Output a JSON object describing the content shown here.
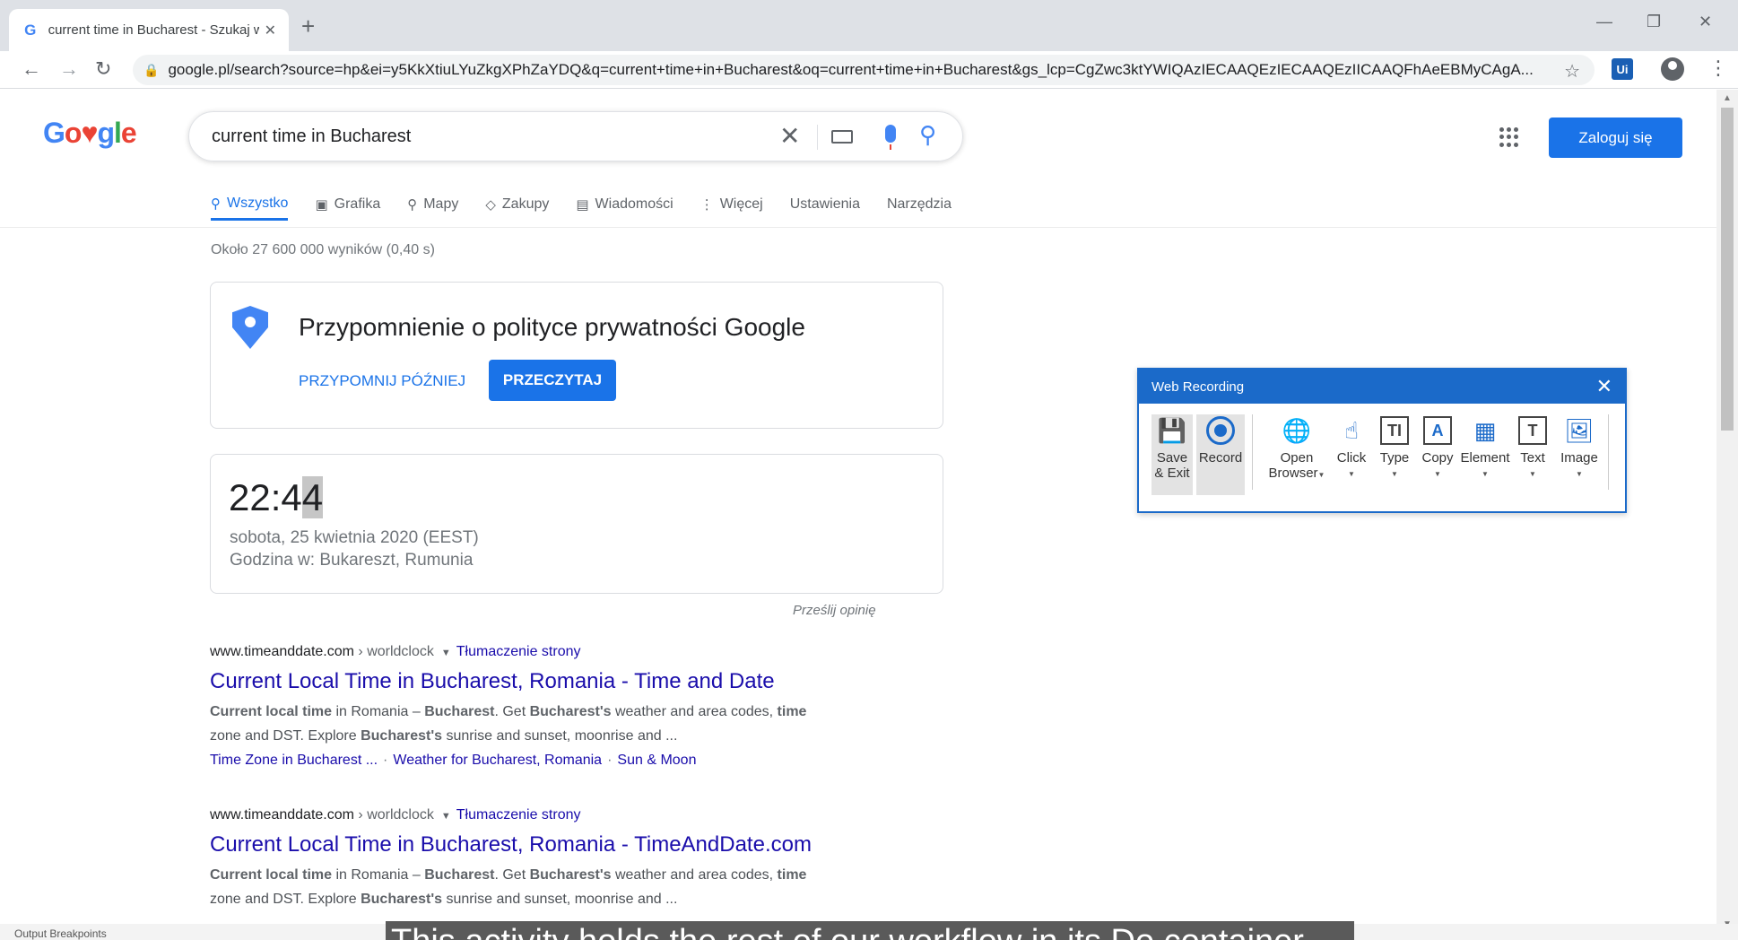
{
  "browser": {
    "tab_title": "current time in Bucharest - Szukaj w Google",
    "url": "google.pl/search?source=hp&ei=y5KkXtiuLYuZkgXPhZaYDQ&q=current+time+in+Bucharest&oq=current+time+in+Bucharest&gs_lcp=CgZwc3ktYWIQAzIECAAQEzIECAAQEzIICAAQFhAeEBMyCAgA...",
    "ext_label": "Ui"
  },
  "google": {
    "query": "current time in Bucharest",
    "signin_label": "Zaloguj się",
    "tabs": [
      {
        "label": "Wszystko",
        "icon": "search-icon"
      },
      {
        "label": "Grafika",
        "icon": "image-icon"
      },
      {
        "label": "Mapy",
        "icon": "map-pin-icon"
      },
      {
        "label": "Zakupy",
        "icon": "tag-icon"
      },
      {
        "label": "Wiadomości",
        "icon": "news-icon"
      },
      {
        "label": "Więcej",
        "icon": "more-vert-icon"
      },
      {
        "label": "Ustawienia"
      },
      {
        "label": "Narzędzia"
      }
    ],
    "stats": "Około 27 600 000 wyników (0,40 s)",
    "privacy": {
      "title": "Przypomnienie o polityce prywatności Google",
      "later": "PRZYPOMNIJ PÓŹNIEJ",
      "read": "PRZECZYTAJ"
    },
    "time_card": {
      "time_main": "22:4",
      "time_highlight": "4",
      "date": "sobota, 25 kwietnia 2020 (EEST)",
      "place": "Godzina w: Bukareszt, Rumunia"
    },
    "feedback": "Prześlij opinię",
    "results": [
      {
        "domain": "www.timeanddate.com",
        "crumb": " › worldclock",
        "translate": "Tłumaczenie strony",
        "title": "Current Local Time in Bucharest, Romania - Time and Date",
        "snippet_line1": [
          "Current local time",
          " in Romania – ",
          "Bucharest",
          ". Get ",
          "Bucharest's",
          " weather and area codes, ",
          "time"
        ],
        "snippet_line2": [
          "zone and DST. Explore ",
          "Bucharest's",
          " sunrise and sunset, moonrise and ..."
        ],
        "links": [
          "Time Zone in Bucharest ...",
          "Weather for Bucharest, Romania",
          "Sun & Moon"
        ]
      },
      {
        "domain": "www.timeanddate.com",
        "crumb": " › worldclock",
        "translate": "Tłumaczenie strony",
        "title": "Current Local Time in Bucharest, Romania - TimeAndDate.com",
        "snippet_line1": [
          "Current local time",
          " in Romania – ",
          "Bucharest",
          ". Get ",
          "Bucharest's",
          " weather and area codes, ",
          "time"
        ],
        "snippet_line2": [
          "zone and DST. Explore ",
          "Bucharest's",
          " sunrise and sunset, moonrise and ..."
        ]
      }
    ]
  },
  "recorder": {
    "title": "Web Recording",
    "tools": [
      {
        "label1": "Save",
        "label2": "& Exit",
        "icon": "save-icon"
      },
      {
        "label1": "Record",
        "icon": "record-icon"
      },
      {
        "label1": "Open",
        "label2": "Browser",
        "icon": "globe-icon"
      },
      {
        "label1": "Click",
        "icon": "click-icon"
      },
      {
        "label1": "Type",
        "icon": "type-icon"
      },
      {
        "label1": "Copy",
        "icon": "copy-icon"
      },
      {
        "label1": "Element",
        "icon": "element-icon"
      },
      {
        "label1": "Text",
        "icon": "text-icon"
      },
      {
        "label1": "Image",
        "icon": "image-icon"
      }
    ]
  },
  "bottom": {
    "left_text": "Output   Breakpoints",
    "caption": "This activity holds the rest of our workflow in its Do container"
  },
  "colors": {
    "accent": "#1a73e8",
    "link": "#1a0dab",
    "recorder_blue": "#1b6ac9"
  }
}
